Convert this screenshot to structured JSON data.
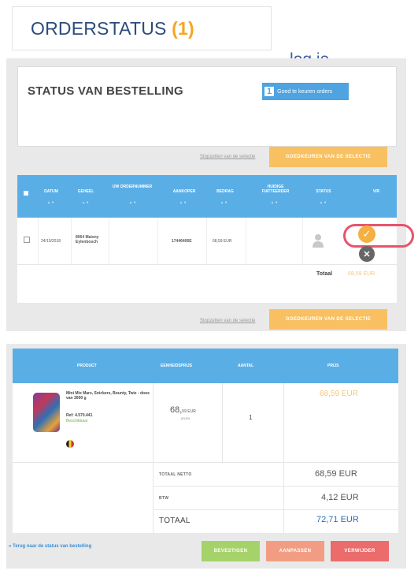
{
  "header": {
    "title": "ORDERSTATUS",
    "count": "(1)",
    "login_link": "log je"
  },
  "status": {
    "heading": "STATUS VAN BESTELLING",
    "toggle_count": "1",
    "toggle_label": "Goed te keuren orders"
  },
  "selection": {
    "deselect_link": "Stopzetten van de selectie",
    "order_button": "GOEDKEUREN VAN DE SELECTIE"
  },
  "orders_table": {
    "columns": [
      "DATUM",
      "GEHEEL",
      "UW ORDERNUMMER",
      "AANKOPER",
      "BEDRAG",
      "HUIDIGE FIATTEERDER",
      "STATUS",
      "V/R"
    ],
    "sort_hint": "▲ ▼",
    "row": {
      "date": "24/10/2018",
      "geheel": "8064 Maisny Eylenbosch",
      "ordernummer": "",
      "aankoper": "17446406E",
      "bedrag": "68,59 EUR",
      "fiatteerder": ""
    },
    "total_label": "Totaal",
    "total_value": "68,59 EUR"
  },
  "product_table": {
    "columns": [
      "PRODUCT",
      "EENHEIDSPRIJS",
      "AANTAL",
      "PRIJS"
    ],
    "product": {
      "name": "Mini Mix Mars, Snickers, Bounty, Twix - doos van 3000 g",
      "ref": "Ref: 4.570.441",
      "stock": "Beschikbaar"
    },
    "unit_price_main": "68,",
    "unit_price_cents": "59 EUR",
    "unit_price_sub": "(EUR)",
    "quantity": "1",
    "line_price": "68,59 EUR",
    "totals": [
      {
        "label": "TOTAAL NETTO",
        "value": "68,59 EUR"
      },
      {
        "label": "BTW",
        "value": "4,12 EUR"
      },
      {
        "label": "TOTAAL",
        "value": "72,71 EUR"
      }
    ]
  },
  "footer": {
    "back_link": "« Terug naar de status van bestelling",
    "confirm": "BEVESTIGEN",
    "edit": "AANPASSEN",
    "delete": "VERWIJDER"
  },
  "colors": {
    "blue": "#5aaee6",
    "orange": "#f8c061",
    "green": "#a6d26a",
    "salmon": "#f29d83",
    "red": "#ec6b6b"
  },
  "icons": [
    "check-icon",
    "close-icon",
    "person-icon",
    "flag-icon"
  ]
}
